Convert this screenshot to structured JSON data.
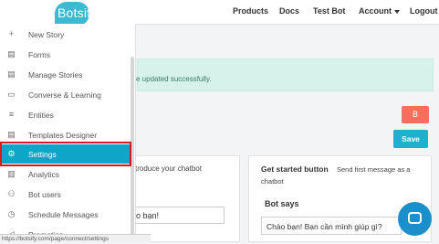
{
  "brand": {
    "name": "Botsify"
  },
  "topnav": {
    "products": "Products",
    "docs": "Docs",
    "test_bot": "Test Bot",
    "account": "Account",
    "logout": "Logout"
  },
  "sidebar": {
    "items": [
      {
        "label": "New Story",
        "icon": "plus-icon"
      },
      {
        "label": "Forms",
        "icon": "document-icon"
      },
      {
        "label": "Manage Stories",
        "icon": "document-icon"
      },
      {
        "label": "Converse & Learning",
        "icon": "chat-icon"
      },
      {
        "label": "Entities",
        "icon": "list-icon"
      },
      {
        "label": "Templates Designer",
        "icon": "document-icon"
      },
      {
        "label": "Settings",
        "icon": "gear-icon",
        "active": true
      },
      {
        "label": "Analytics",
        "icon": "bar-chart-icon"
      },
      {
        "label": "Bot users",
        "icon": "users-icon"
      },
      {
        "label": "Schedule Messages",
        "icon": "clock-icon"
      },
      {
        "label": "Promotion",
        "icon": "megaphone-icon"
      }
    ]
  },
  "alert": {
    "text": "e updated successfully."
  },
  "buttons": {
    "b_label": "B",
    "save_label": "Save"
  },
  "left_card": {
    "header_text": "troduce your chatbot",
    "input_value": "o bạn!"
  },
  "get_started": {
    "title": "Get started button",
    "desc": "Send first message as a",
    "desc2": "chatbot",
    "bot_says": "Bot says",
    "input_value": "Chào bạn! Bạn cần mình giúp gì?"
  },
  "statusbar": {
    "url": "https://botsify.com/page/connect/settings"
  },
  "colors": {
    "accent": "#0ea5c9",
    "danger": "#f2705c",
    "highlight": "#d71a1a"
  }
}
